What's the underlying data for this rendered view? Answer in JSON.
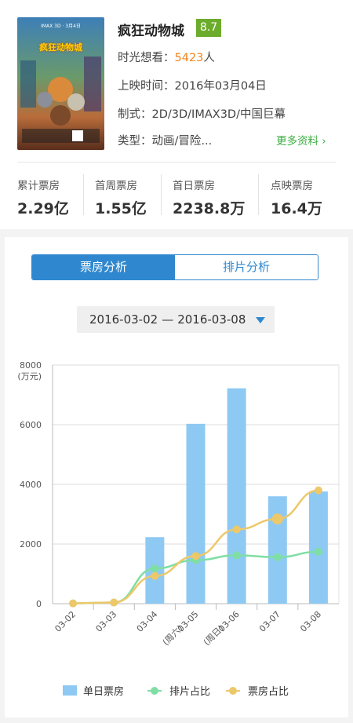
{
  "movie": {
    "title": "疯狂动物城",
    "score": "8.7",
    "want_label": "时光想看：",
    "want_count": "5423",
    "want_unit": "人",
    "release": "上映时间：2016年03月04日",
    "format": "制式：2D/3D/IMAX3D/中国巨幕",
    "genre": "类型：动画/冒险...",
    "more_link": "更多资料 ›",
    "poster_title": "疯狂动物城",
    "poster_tag": "IMAX 3D · 3月4日"
  },
  "stats": [
    {
      "label": "累计票房",
      "value": "2.29亿"
    },
    {
      "label": "首周票房",
      "value": "1.55亿"
    },
    {
      "label": "首日票房",
      "value": "2238.8万"
    },
    {
      "label": "点映票房",
      "value": "16.4万"
    }
  ],
  "tabs": {
    "active": "票房分析",
    "inactive": "排片分析"
  },
  "date_range": {
    "start": "2016-03-02",
    "separator": "—",
    "end": "2016-03-08"
  },
  "colors": {
    "accent": "#2f88cf",
    "score_bg": "#6cac2c",
    "bar": "#8ec9f3",
    "seat_line": "#7fdea3",
    "box_line": "#edc86a",
    "highlight": "#f0841f",
    "link": "#3bae41"
  },
  "chart_data": {
    "type": "bar",
    "categories": [
      "03-02",
      "03-03",
      "03-04",
      "03-05",
      "03-06",
      "03-07",
      "03-08"
    ],
    "category_sublabels": [
      "",
      "",
      "",
      "(周六)",
      "(周日)",
      "",
      ""
    ],
    "ylabel": "(万元)",
    "ylim": [
      0,
      8000
    ],
    "yticks": [
      0,
      2000,
      4000,
      6000,
      8000
    ],
    "grid": true,
    "series": [
      {
        "name": "单日票房",
        "kind": "bar",
        "values": [
          0,
          0,
          2230,
          6030,
          7220,
          3600,
          3760
        ]
      },
      {
        "name": "排片占比",
        "kind": "line",
        "values": [
          10,
          40,
          1180,
          1460,
          1620,
          1560,
          1740
        ]
      },
      {
        "name": "票房占比",
        "kind": "line",
        "values": [
          10,
          40,
          930,
          1600,
          2490,
          2840,
          3800
        ]
      }
    ],
    "legend": "bottom"
  }
}
